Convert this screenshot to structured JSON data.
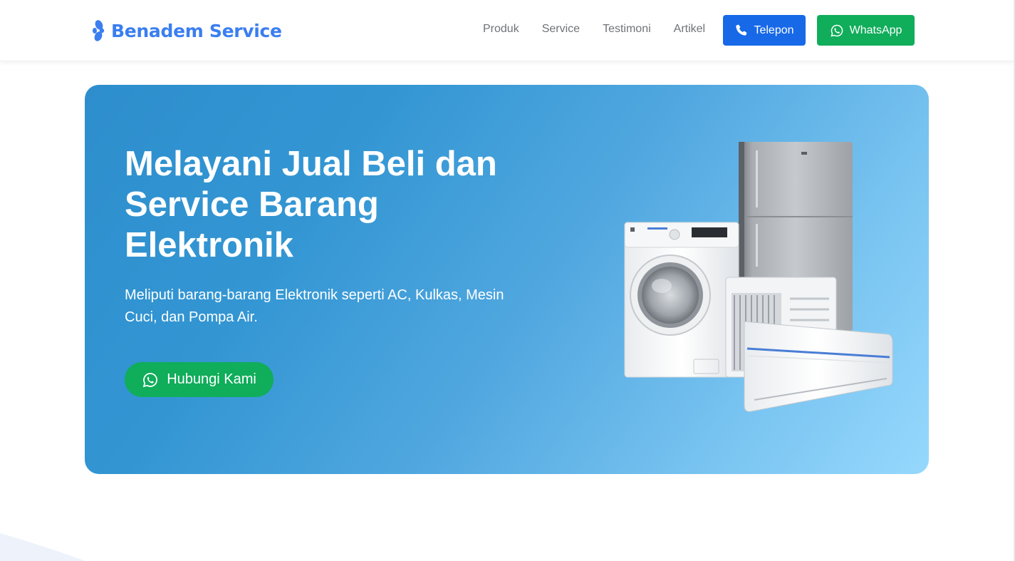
{
  "brand": {
    "name": "Benadem Service",
    "color": "#3a7ef0",
    "icon": "fan-icon"
  },
  "nav": {
    "links": [
      "Produk",
      "Service",
      "Testimoni",
      "Artikel"
    ]
  },
  "header_buttons": {
    "telepon": {
      "label": "Telepon",
      "icon": "phone-icon",
      "color": "#1769e8"
    },
    "whatsapp": {
      "label": "WhatsApp",
      "icon": "whatsapp-icon",
      "color": "#10ad5a"
    }
  },
  "hero": {
    "title": "Melayani Jual Beli dan Service Barang Elektronik",
    "subtitle": "Meliputi barang-barang Elektronik seperti AC, Kulkas, Mesin Cuci, dan Pompa Air.",
    "cta_label": "Hubungi Kami",
    "cta_icon": "whatsapp-icon",
    "gradient": [
      "#2e8ecd",
      "#96d8fd"
    ],
    "image": "appliances-illustration"
  }
}
